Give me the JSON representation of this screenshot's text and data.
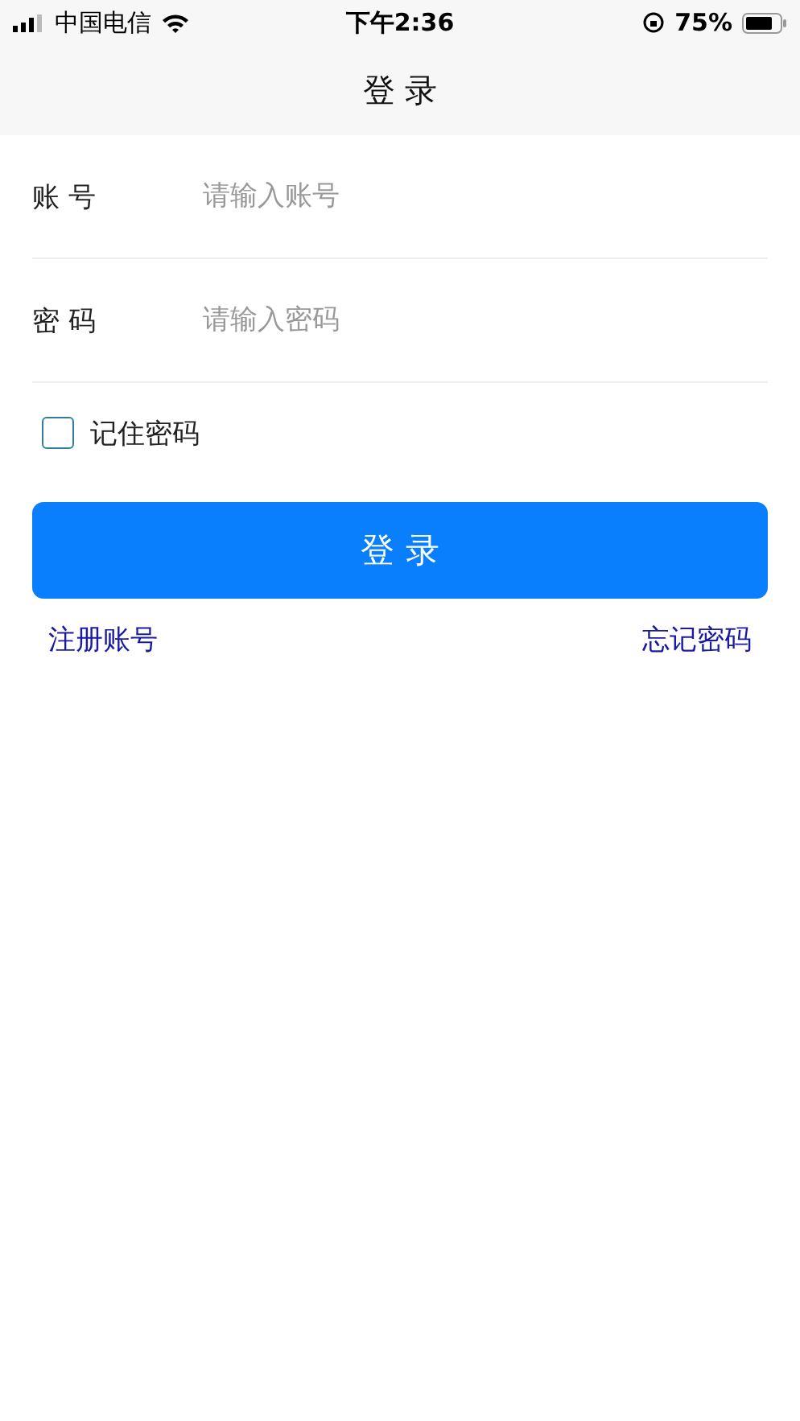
{
  "status_bar": {
    "carrier": "中国电信",
    "time": "下午2:36",
    "battery_percent": "75%"
  },
  "nav_bar": {
    "title": "登 录"
  },
  "fields": [
    {
      "label": "账 号",
      "placeholder": "请输入账号"
    },
    {
      "label": "密 码",
      "placeholder": "请输入密码"
    }
  ],
  "remember": {
    "label": "记住密码",
    "checked": false
  },
  "login_button": {
    "label": "登 录"
  },
  "links": [
    {
      "label": "注册账号"
    },
    {
      "label": "忘记密码"
    }
  ]
}
